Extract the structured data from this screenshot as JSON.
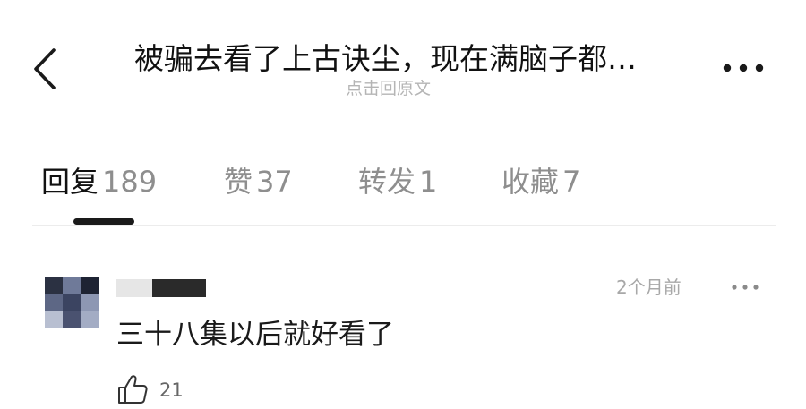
{
  "header": {
    "title": "被骗去看了上古诀尘，现在满脑子都…",
    "subtitle": "点击回原文",
    "back_icon": "chevron-left-icon",
    "more_icon": "more-horizontal-icon"
  },
  "tabs": [
    {
      "label": "回复",
      "count": "189",
      "active": true
    },
    {
      "label": "赞",
      "count": "37",
      "active": false
    },
    {
      "label": "转发",
      "count": "1",
      "active": false
    },
    {
      "label": "收藏",
      "count": "7",
      "active": false
    }
  ],
  "comment": {
    "avatar_icon": "blurred-avatar",
    "username_icon": "blurred-username",
    "timestamp": "2个月前",
    "more_icon": "more-horizontal-icon",
    "text": "三十八集以后就好看了",
    "like_icon": "thumbs-up-icon",
    "like_count": "21"
  },
  "colors": {
    "text_primary": "#111111",
    "text_secondary": "#8e8e8e",
    "text_hint": "#b5b5b5",
    "underline": "#1a1a1a",
    "divider": "#ececec"
  }
}
